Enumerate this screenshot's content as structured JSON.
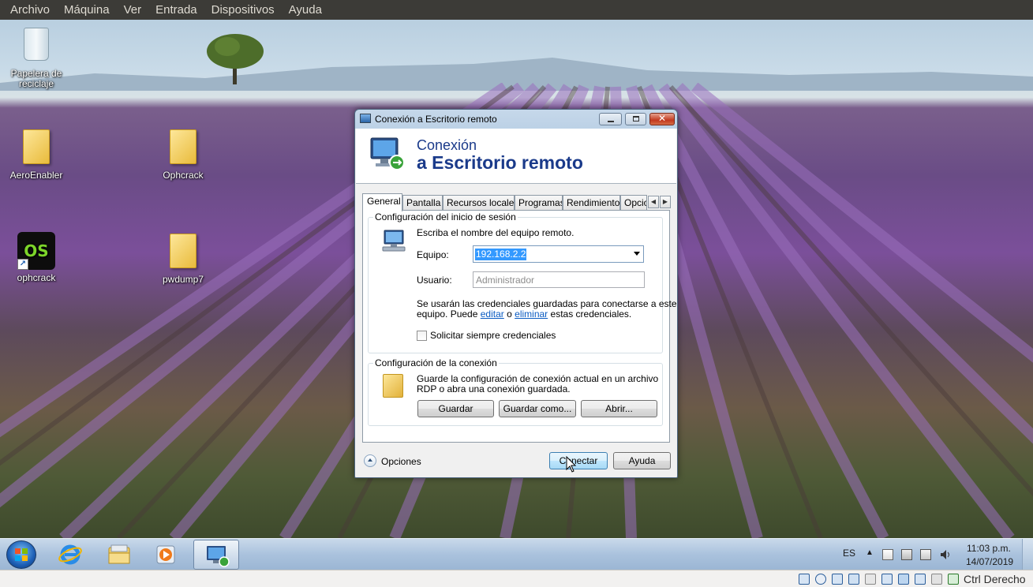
{
  "host_menu": [
    "Archivo",
    "Máquina",
    "Ver",
    "Entrada",
    "Dispositivos",
    "Ayuda"
  ],
  "desktop_icons": {
    "recycle_bin": "Papelera de reciclaje",
    "aeroenabler": "AeroEnabler",
    "ophcrack_folder": "Ophcrack",
    "ophcrack_app": "ophcrack",
    "ophcrack_app_badge": "OS",
    "pwdump7": "pwdump7"
  },
  "window": {
    "title": "Conexión a Escritorio remoto",
    "banner_line1": "Conexión",
    "banner_line2": "a Escritorio remoto",
    "tabs": [
      "General",
      "Pantalla",
      "Recursos locales",
      "Programas",
      "Rendimiento",
      "Opcio"
    ],
    "active_tab": "General",
    "logon": {
      "group_title": "Configuración del inicio de sesión",
      "instruction": "Escriba el nombre del equipo remoto.",
      "computer_label": "Equipo:",
      "computer_value": "192.168.2.2",
      "user_label": "Usuario:",
      "user_placeholder": "Administrador",
      "cred_text_1": "Se usarán las credenciales guardadas para conectarse a este",
      "cred_text_2a": "equipo.  Puede",
      "edit_link": "editar",
      "cred_text_2b": "o",
      "delete_link": "eliminar",
      "cred_text_2c": "estas credenciales.",
      "always_ask": "Solicitar siempre credenciales"
    },
    "connection": {
      "group_title": "Configuración de la conexión",
      "desc_1": "Guarde la configuración de conexión actual en un archivo",
      "desc_2": "RDP o abra una conexión guardada.",
      "save": "Guardar",
      "save_as": "Guardar como...",
      "open": "Abrir..."
    },
    "options_label": "Opciones",
    "connect": "Conectar",
    "help": "Ayuda"
  },
  "taskbar": {
    "language": "ES",
    "time": "11:03 p.m.",
    "date": "14/07/2019"
  },
  "vbox_status": {
    "host_key": "Ctrl Derecho"
  },
  "colors": {
    "banner_title": "#1a3a8a",
    "link": "#0a5bc2",
    "selection": "#3399ff"
  }
}
